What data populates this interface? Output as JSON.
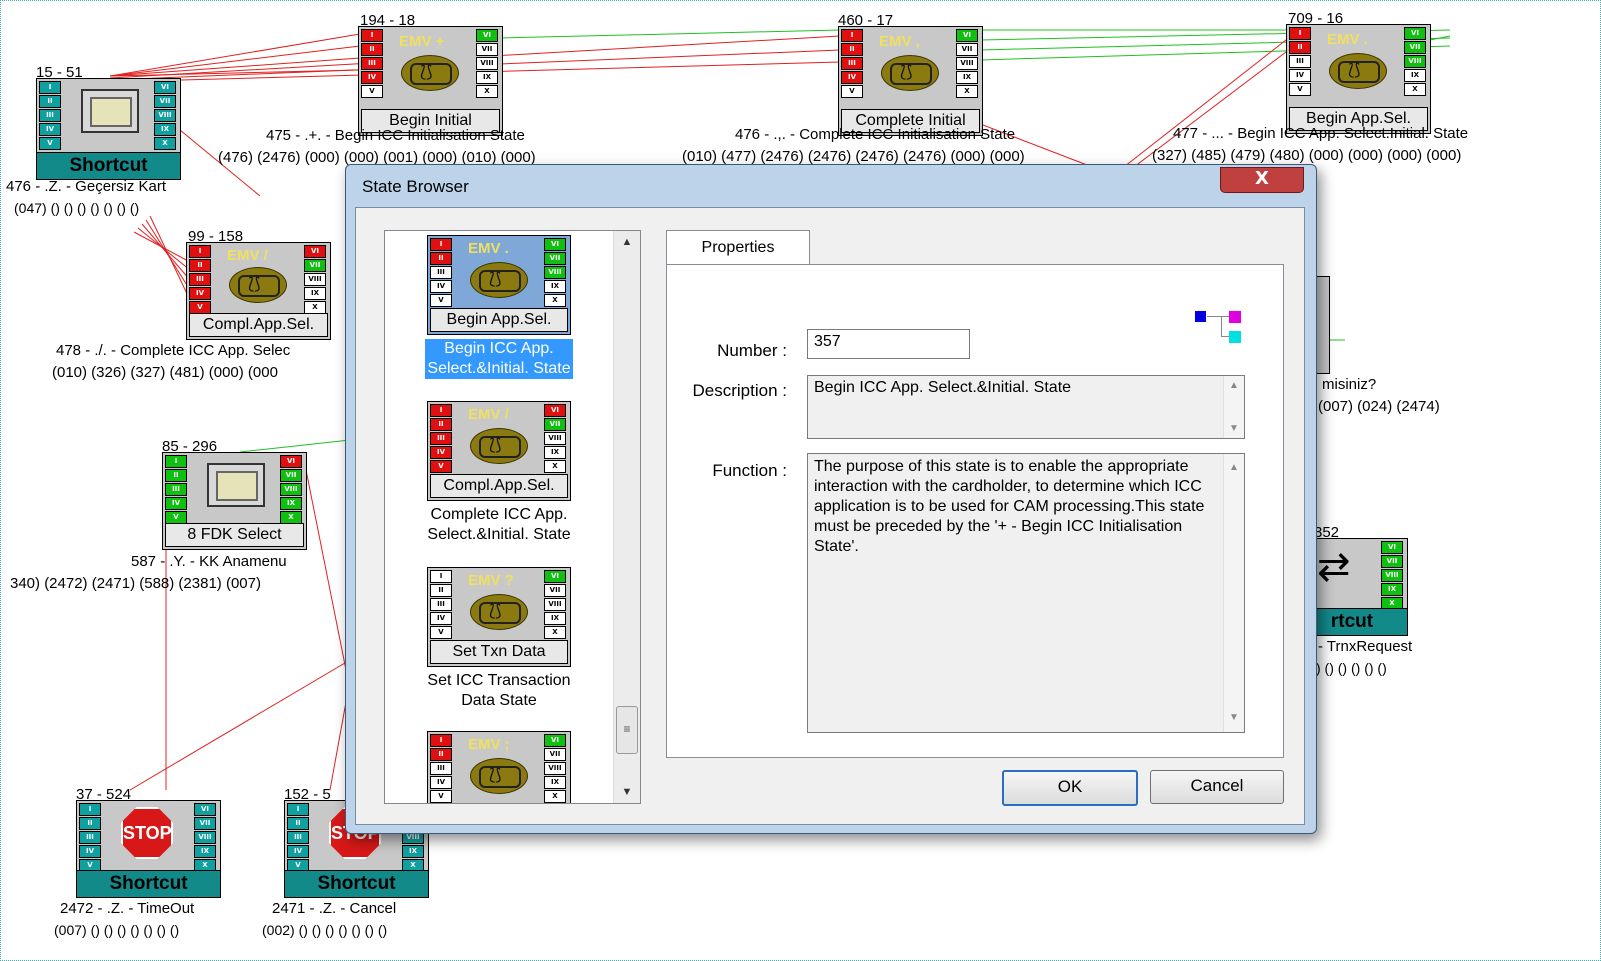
{
  "canvas": {
    "nodes": [
      {
        "id": "n15",
        "header": "15 - 51",
        "label": "476 - .Z. - Geçersiz Kart",
        "refs": "(047) () () () () () () ()"
      },
      {
        "id": "n194",
        "header": "194 - 18",
        "emv": "EMV +",
        "caption": "Begin Initial",
        "label": "475 - .+. - Begin ICC Initialisation State",
        "refs": "(476) (2476) (000) (000) (001) (000) (010) (000)"
      },
      {
        "id": "n460",
        "header": "460 - 17",
        "emv": "EMV ,",
        "caption": "Complete Initial",
        "label": "476 - .,. - Complete ICC Initialisation State",
        "refs": "(010) (477) (2476) (2476) (2476) (2476) (000) (000)"
      },
      {
        "id": "n709",
        "header": "709 - 16",
        "emv": "EMV .",
        "caption": "Begin App.Sel.",
        "label": "477 - ... - Begin ICC App. Select.Initial. State",
        "refs": "(327) (485) (479) (480) (000) (000) (000) (000)"
      },
      {
        "id": "n99",
        "header": "99 - 158",
        "emv": "EMV /",
        "caption": "Compl.App.Sel.",
        "label": "478 - ./. - Complete ICC App. Selec",
        "refs": "(010) (326) (327) (481) (000) (000"
      },
      {
        "id": "n85",
        "header": "85 - 296",
        "caption": "8 FDK Select",
        "label": "587 - .Y. - KK Anamenu",
        "refs": "340) (2472) (2471) (588) (2381) (007)"
      },
      {
        "id": "nRight",
        "label": "misiniz?",
        "refs": "(007) (024) (2474)"
      },
      {
        "id": "n352",
        "header": "352",
        "shortcut": "rtcut",
        "label": "- TrnxRequest",
        "refs": ") () () () () ()"
      },
      {
        "id": "n37",
        "header": "37 - 524",
        "stop": "STOP",
        "shortcut": "Shortcut",
        "label": "2472 - .Z. - TimeOut",
        "refs": "(007) () () () () () () ()"
      },
      {
        "id": "n152",
        "header": "152 - 5",
        "stop": "STOP",
        "shortcut": "Shortcut",
        "label": "2471 - .Z. - Cancel",
        "refs": "(002) () () () () () () ()"
      }
    ],
    "shortcut_label": "Shortcut",
    "ports_left": [
      "I",
      "II",
      "III",
      "IV",
      "V"
    ],
    "ports_right": [
      "VI",
      "VII",
      "VIII",
      "IX",
      "X"
    ]
  },
  "dialog": {
    "title": "State Browser",
    "close_glyph": "X",
    "list_items": [
      {
        "emv": "EMV .",
        "caption": "Begin App.Sel.",
        "label_1": "Begin ICC App.",
        "label_2": "Select.&Initial. State",
        "selected": true
      },
      {
        "emv": "EMV /",
        "caption": "Compl.App.Sel.",
        "label_1": "Complete ICC App.",
        "label_2": "Select.&Initial. State",
        "selected": false
      },
      {
        "emv": "EMV ?",
        "caption": "Set Txn Data",
        "label_1": "Set ICC Transaction",
        "label_2": "Data State",
        "selected": false
      },
      {
        "emv": "EMV ;",
        "caption": "",
        "label_1": "",
        "label_2": "",
        "selected": false
      }
    ],
    "tab": "Properties",
    "number_label": "Number :",
    "number_value": "357",
    "description_label": "Description :",
    "description_value": "Begin ICC App. Select.&Initial. State",
    "function_label": "Function :",
    "function_value": "The purpose of this state is to enable the appropriate interaction with the cardholder, to determine which ICC application is to be used for CAM processing.This state must be preceded by the '+ - Begin ICC Initialisation State'.",
    "ok_label": "OK",
    "cancel_label": "Cancel"
  },
  "colors": {
    "port_red": "#e01010",
    "port_green": "#10c010",
    "shortcut_teal": "#138a8a",
    "selection": "#3399ff",
    "wire_red": "#e02020",
    "wire_green": "#20c020"
  }
}
